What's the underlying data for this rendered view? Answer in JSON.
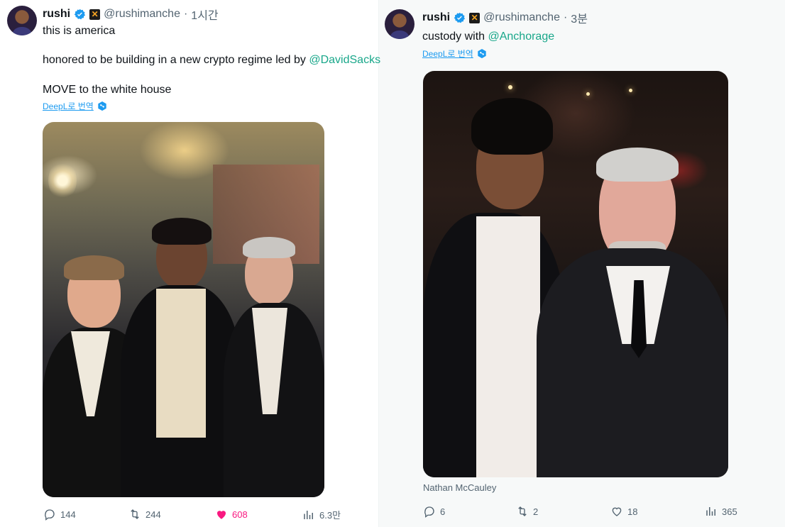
{
  "left_tweet": {
    "author_name": "rushi",
    "handle": "@rushimanche",
    "separator": "·",
    "time": "1시간",
    "line1": "this is america",
    "line2_prefix": "honored to be building in a new crypto regime led by ",
    "line2_mention": "@DavidSacks",
    "line3": "MOVE to the white house",
    "translate_label": "DeepL로 번역",
    "stats": {
      "replies": "144",
      "retweets": "244",
      "likes": "608",
      "views": "6.3만"
    },
    "liked": true
  },
  "right_tweet": {
    "author_name": "rushi",
    "handle": "@rushimanche",
    "separator": "·",
    "time": "3분",
    "text_prefix": "custody with ",
    "text_mention": "@Anchorage",
    "translate_label": "DeepL로 번역",
    "photo_caption": "Nathan McCauley",
    "stats": {
      "replies": "6",
      "retweets": "2",
      "likes": "18",
      "views": "365"
    },
    "liked": false
  },
  "colors": {
    "mention": "#19a78a",
    "link": "#1d9bf0",
    "muted": "#536471",
    "like_active": "#f91880"
  },
  "icons": [
    "verified-badge-icon",
    "move-badge-icon",
    "deepl-icon",
    "reply-icon",
    "retweet-icon",
    "like-icon",
    "views-icon"
  ]
}
